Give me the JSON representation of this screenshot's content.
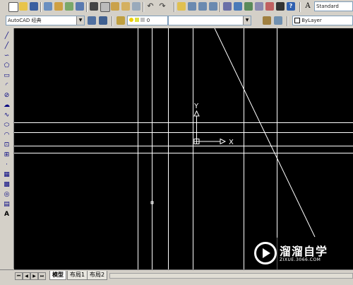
{
  "toolbar": {
    "style_label": "Standard",
    "workspace": "AutoCAD 经典",
    "layer": "0",
    "linetype": "ByLayer"
  },
  "draw_tools": [
    "line",
    "construction-line",
    "polyline",
    "polygon",
    "rectangle",
    "arc",
    "circle",
    "revision-cloud",
    "spline",
    "ellipse",
    "ellipse-arc",
    "insert-block",
    "make-block",
    "point",
    "hatch",
    "gradient",
    "region",
    "table",
    "multiline-text"
  ],
  "ucs": {
    "y_label": "Y",
    "x_label": "X"
  },
  "tabs": [
    "模型",
    "布局1",
    "布局2"
  ],
  "watermark": {
    "title": "溜溜自学",
    "url": "ZIXUE.3066.COM"
  }
}
